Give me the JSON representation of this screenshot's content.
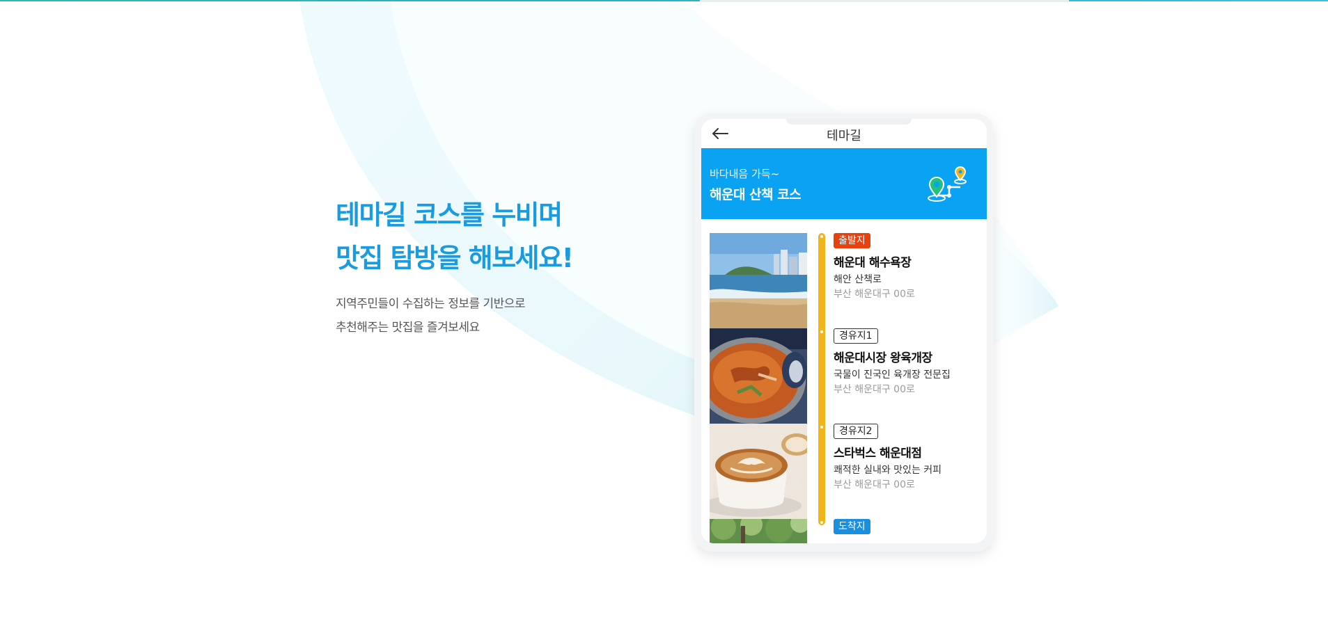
{
  "hero": {
    "title_line1": "테마길 코스를 누비며",
    "title_line2": "맛집 탐방을 해보세요!",
    "subtitle_line1": "지역주민들이 수집하는 정보를 기반으로",
    "subtitle_line2": "추천해주는 맛집을 즐겨보세요"
  },
  "phone": {
    "header_title": "테마길",
    "back_icon": "arrow-left-icon",
    "banner": {
      "small_text": "바다내음 가득~",
      "title": "해운대 산책 코스",
      "icon": "route-map-icon"
    },
    "stops": [
      {
        "badge": "출발지",
        "name": "해운대 해수욕장",
        "desc": "해안 산책로",
        "address": "부산 해운대구 00로",
        "image": "beach-photo"
      },
      {
        "badge": "경유지1",
        "name": "해운대시장 왕육개장",
        "desc": "국물이 진국인 육개장 전문집",
        "address": "부산 해운대구 00로",
        "image": "yukgaejang-photo"
      },
      {
        "badge": "경유지2",
        "name": "스타벅스 해운대점",
        "desc": "쾌적한 실내와 맛있는 커피",
        "address": "부산 해운대구 00로",
        "image": "coffee-photo"
      },
      {
        "badge": "도착지",
        "image": "forest-photo"
      }
    ]
  },
  "colors": {
    "accent": "#1a9be0",
    "banner": "#0aa2f2",
    "timeline": "#f2b41b",
    "start_badge": "#e8410e",
    "end_badge": "#1a8fe0"
  }
}
